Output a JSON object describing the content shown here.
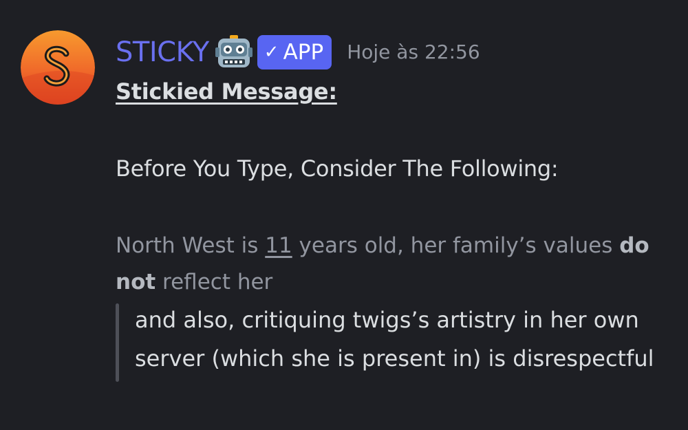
{
  "author": {
    "name": "STICKY",
    "avatar_icon": "sticky-logo-icon",
    "emoji_icon": "robot-face-icon",
    "badge": {
      "check": "✓",
      "label": "APP",
      "color": "#5865f2"
    },
    "name_color": "#6a70f0"
  },
  "timestamp": "Hoje às 22:56",
  "message": {
    "title": "Stickied Message:",
    "intro": "Before You Type, Consider The Following:",
    "note": {
      "part1": "North West is ",
      "number": "11",
      "part2": " years old, her family’s values ",
      "emphasis": "do not",
      "part3": " reflect her"
    },
    "quote": "and also, critiquing twigs’s artistry in her own server (which she is present in) is disrespectful"
  },
  "colors": {
    "background": "#1e1f24",
    "text": "#dbdee1",
    "muted": "#9296a0",
    "quote_bar": "#4e5058"
  }
}
